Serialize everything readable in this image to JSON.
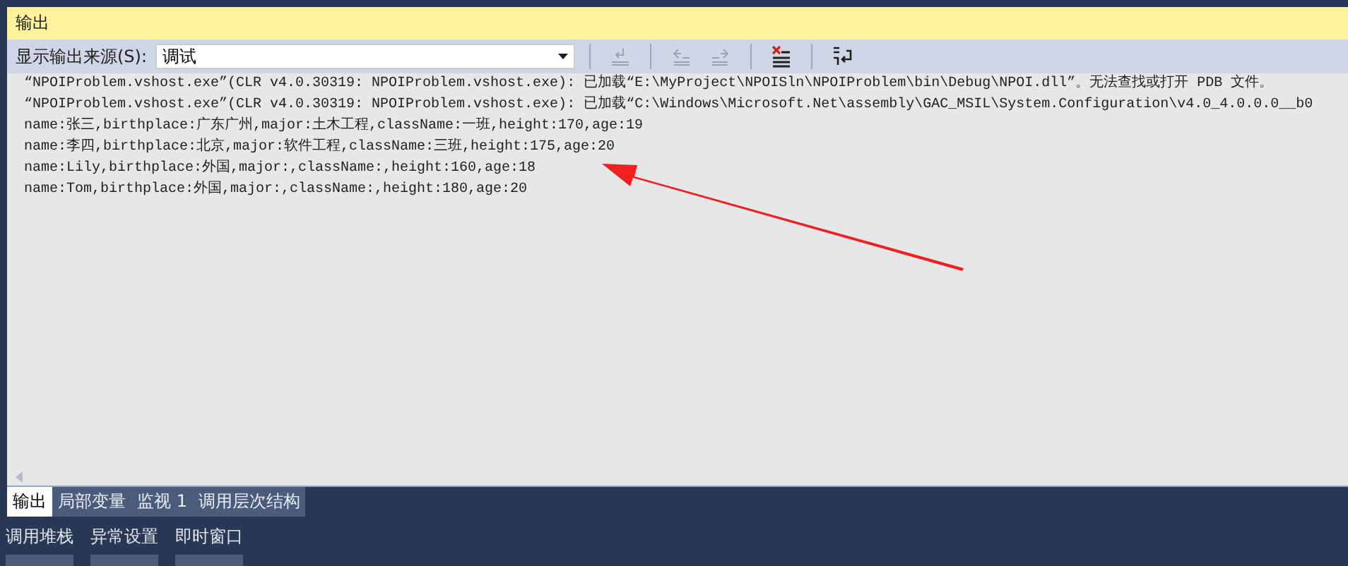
{
  "panel": {
    "title": "输出"
  },
  "toolbar": {
    "source_label": "显示输出来源(S):",
    "source_value": "调试",
    "buttons": [
      {
        "kind": "find-prev",
        "disabled": true
      },
      {
        "kind": "prev",
        "disabled": true
      },
      {
        "kind": "next",
        "disabled": true
      },
      {
        "kind": "clear",
        "disabled": false
      },
      {
        "kind": "wrap",
        "disabled": false
      }
    ]
  },
  "output_lines": [
    "“NPOIProblem.vshost.exe”(CLR v4.0.30319: NPOIProblem.vshost.exe): 已加载“E:\\MyProject\\NPOISln\\NPOIProblem\\bin\\Debug\\NPOI.dll”。无法查找或打开 PDB 文件。",
    "“NPOIProblem.vshost.exe”(CLR v4.0.30319: NPOIProblem.vshost.exe): 已加载“C:\\Windows\\Microsoft.Net\\assembly\\GAC_MSIL\\System.Configuration\\v4.0_4.0.0.0__b0",
    "name:张三,birthplace:广东广州,major:土木工程,className:一班,height:170,age:19",
    "name:李四,birthplace:北京,major:软件工程,className:三班,height:175,age:20",
    "name:Lily,birthplace:外国,major:,className:,height:160,age:18",
    "name:Tom,birthplace:外国,major:,className:,height:180,age:20"
  ],
  "tabs": [
    {
      "label": "输出",
      "selected": true
    },
    {
      "label": "局部变量",
      "selected": false
    },
    {
      "label": "监视 1",
      "selected": false
    },
    {
      "label": "调用层次结构",
      "selected": false
    }
  ],
  "tabs_2": [
    {
      "label": "调用堆栈",
      "selected": false
    },
    {
      "label": "异常设置",
      "selected": false
    },
    {
      "label": "即时窗口",
      "selected": false
    }
  ]
}
